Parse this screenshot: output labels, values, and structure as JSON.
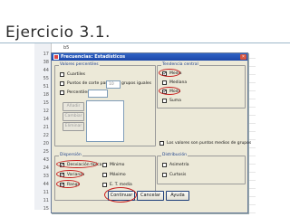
{
  "slide": {
    "title": "Ejercicio 3.1."
  },
  "spreadsheet": {
    "header_cell": "b5",
    "row_numbers": [
      "17",
      "38",
      "44",
      "55",
      "51",
      "18",
      "15",
      "12",
      "14",
      "21",
      "22",
      "20",
      "25",
      "43",
      "24",
      "33",
      "44",
      "11",
      "11",
      "15"
    ]
  },
  "dialog": {
    "title": "Frecuencias: Estadísticos",
    "percentile_group": {
      "label": "Valores percentiles",
      "cuartiles": "Cuartiles",
      "puntos_corte": "Puntos de corte para:",
      "puntos_corte_value": "10",
      "grupos_iguales": "grupos iguales",
      "percentiles": "Percentiles:",
      "add_button": "Añadir",
      "change_button": "Cambiar",
      "remove_button": "Eliminar"
    },
    "central_group": {
      "label": "Tendencia central",
      "media": "Media",
      "mediana": "Mediana",
      "moda": "Moda",
      "suma": "Suma"
    },
    "midpoints_label": "Los valores son puntos medios de grupos",
    "dispersion_group": {
      "label": "Dispersión",
      "desviacion": "Desviación típica",
      "minimo": "Mínimo",
      "varianza": "Varianza",
      "maximo": "Máximo",
      "rango": "Rango",
      "et_media": "E. T. media"
    },
    "distribution_group": {
      "label": "Distribución",
      "asimetria": "Asimetría",
      "curtosis": "Curtosis"
    },
    "buttons": {
      "continue": "Continuar",
      "cancel": "Cancelar",
      "help": "Ayuda"
    },
    "checked": {
      "media": true,
      "moda": true,
      "desviacion": true,
      "varianza": true,
      "rango": true
    },
    "annotation_color": "#c81e1e"
  }
}
